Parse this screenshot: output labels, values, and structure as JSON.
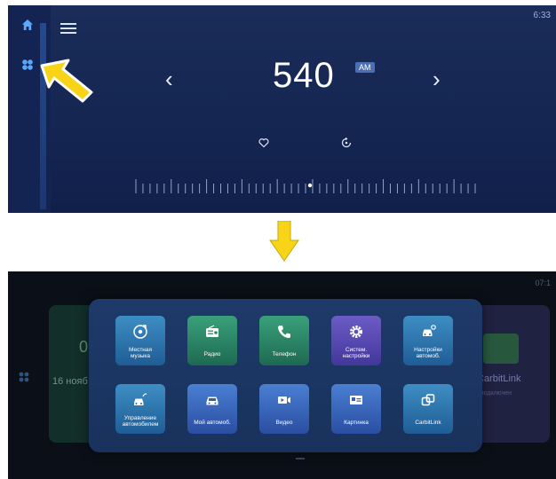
{
  "radio_screen": {
    "clock": "6:33",
    "frequency": "540",
    "band": "AM",
    "prev_symbol": "‹",
    "next_symbol": "›",
    "icons": [
      "home-icon",
      "apps-icon",
      "menu-icon",
      "heart-icon",
      "scan-icon"
    ]
  },
  "transition_arrow": {
    "color": "#f7d417"
  },
  "app_menu_screen": {
    "clock": "07:1",
    "background": {
      "left_card_value": "0",
      "left_card_date": "16 нояб",
      "right_card_title": "CarbitLink",
      "right_card_subtitle": "не подключен"
    },
    "apps": [
      {
        "label": "Местная\nмузыка",
        "icon": "music-icon",
        "color": "blue"
      },
      {
        "label": "Радио",
        "icon": "radio-icon",
        "color": "green"
      },
      {
        "label": "Телефон",
        "icon": "phone-icon",
        "color": "green"
      },
      {
        "label": "Систем.\nнастройки",
        "icon": "settings-icon",
        "color": "purple"
      },
      {
        "label": "Настройки\nавтомоб.",
        "icon": "car-settings-icon",
        "color": "blue"
      },
      {
        "label": "Управление\nавтомобилем",
        "icon": "car-control-icon",
        "color": "blue"
      },
      {
        "label": "Мой автомоб.",
        "icon": "car-icon",
        "color": "navy"
      },
      {
        "label": "Видео",
        "icon": "video-icon",
        "color": "navy"
      },
      {
        "label": "Картинка",
        "icon": "picture-icon",
        "color": "navy"
      },
      {
        "label": "CarbitLink",
        "icon": "link-icon",
        "color": "blue"
      }
    ]
  },
  "colors": {
    "radio_bg": "#152652",
    "panel_bg": "#1e3a6a",
    "highlight_arrow": "#f7d417"
  }
}
